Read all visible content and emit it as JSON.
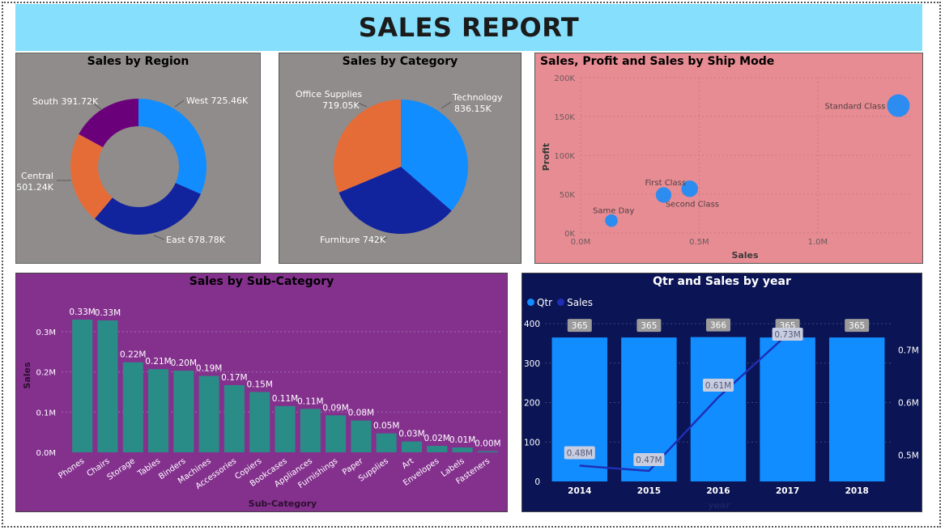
{
  "report": {
    "title": "SALES REPORT"
  },
  "colors": {
    "banner": "#86DFFC",
    "west": "#118DFF",
    "east": "#12239E",
    "central": "#E66C37",
    "south": "#6B007B",
    "bar_teal": "#2A8C86",
    "qtr_bar": "#118DFF",
    "sales_line": "#1F2FB5",
    "scatter_point": "#2D8CF0"
  },
  "chart_data": [
    {
      "id": "region",
      "type": "pie",
      "variant": "donut",
      "title": "Sales by Region",
      "slices": [
        {
          "label": "West",
          "display": "725.46K",
          "value": 725.46
        },
        {
          "label": "East",
          "display": "678.78K",
          "value": 678.78
        },
        {
          "label": "Central",
          "display": "501.24K",
          "value": 501.24
        },
        {
          "label": "South",
          "display": "391.72K",
          "value": 391.72
        }
      ]
    },
    {
      "id": "category",
      "type": "pie",
      "title": "Sales by Category",
      "slices": [
        {
          "label": "Technology",
          "display": "836.15K",
          "value": 836.15
        },
        {
          "label": "Furniture",
          "display": "742K",
          "value": 742
        },
        {
          "label": "Office Supplies",
          "display": "719.05K",
          "value": 719.05
        }
      ]
    },
    {
      "id": "shipmode",
      "type": "scatter",
      "title": "Sales, Profit and Sales by Ship Mode",
      "xlabel": "Sales",
      "ylabel": "Profit",
      "xlim": [
        0,
        1.4
      ],
      "ylim": [
        0,
        200
      ],
      "xticks": [
        "0.0M",
        "0.5M",
        "1.0M"
      ],
      "yticks": [
        "0K",
        "50K",
        "100K",
        "150K",
        "200K"
      ],
      "points": [
        {
          "label": "Standard Class",
          "x": 1.34,
          "y": 164,
          "size": 1.34
        },
        {
          "label": "Second Class",
          "x": 0.46,
          "y": 57,
          "size": 0.46
        },
        {
          "label": "First Class",
          "x": 0.35,
          "y": 49,
          "size": 0.35
        },
        {
          "label": "Same Day",
          "x": 0.13,
          "y": 16,
          "size": 0.13
        }
      ]
    },
    {
      "id": "subcategory",
      "type": "bar",
      "title": "Sales by Sub-Category",
      "xlabel": "Sub-Category",
      "ylabel": "Sales",
      "ylim": [
        0,
        0.33
      ],
      "yticks": [
        "0.0M",
        "0.1M",
        "0.2M",
        "0.3M"
      ],
      "categories": [
        "Phones",
        "Chairs",
        "Storage",
        "Tables",
        "Binders",
        "Machines",
        "Accessories",
        "Copiers",
        "Bookcases",
        "Appliances",
        "Furnishings",
        "Paper",
        "Supplies",
        "Art",
        "Envelopes",
        "Labels",
        "Fasteners"
      ],
      "values": [
        0.33,
        0.328,
        0.224,
        0.207,
        0.203,
        0.19,
        0.167,
        0.15,
        0.115,
        0.108,
        0.092,
        0.079,
        0.047,
        0.027,
        0.016,
        0.012,
        0.003
      ],
      "labels": [
        "0.33M",
        "0.33M",
        "0.22M",
        "0.21M",
        "0.20M",
        "0.19M",
        "0.17M",
        "0.15M",
        "0.11M",
        "0.11M",
        "0.09M",
        "0.08M",
        "0.05M",
        "0.03M",
        "0.02M",
        "0.01M",
        "0.00M"
      ]
    },
    {
      "id": "qtr_year",
      "type": "bar",
      "combo": "bar+line",
      "title": "Qtr and Sales by year",
      "xlabel": "year",
      "legend": [
        "Qtr",
        "Sales"
      ],
      "categories": [
        "2014",
        "2015",
        "2016",
        "2017",
        "2018"
      ],
      "series": [
        {
          "name": "Qtr",
          "type": "bar",
          "values": [
            365,
            365,
            366,
            365,
            365
          ],
          "labels": [
            "365",
            "365",
            "366",
            "365",
            "365"
          ]
        },
        {
          "name": "Sales",
          "type": "line",
          "values": [
            0.48,
            0.47,
            0.61,
            0.73
          ],
          "labels": [
            "0.48M",
            "0.47M",
            "0.61M",
            "0.73M"
          ]
        }
      ],
      "ylim_left": [
        0,
        400
      ],
      "yticks_left": [
        "0",
        "100",
        "200",
        "300",
        "400"
      ],
      "ylim_right": [
        0.45,
        0.75
      ],
      "yticks_right": [
        {
          "label": "0.5M",
          "value": 0.5
        },
        {
          "label": "0.6M",
          "value": 0.6
        },
        {
          "label": "0.7M",
          "value": 0.7
        }
      ]
    }
  ]
}
